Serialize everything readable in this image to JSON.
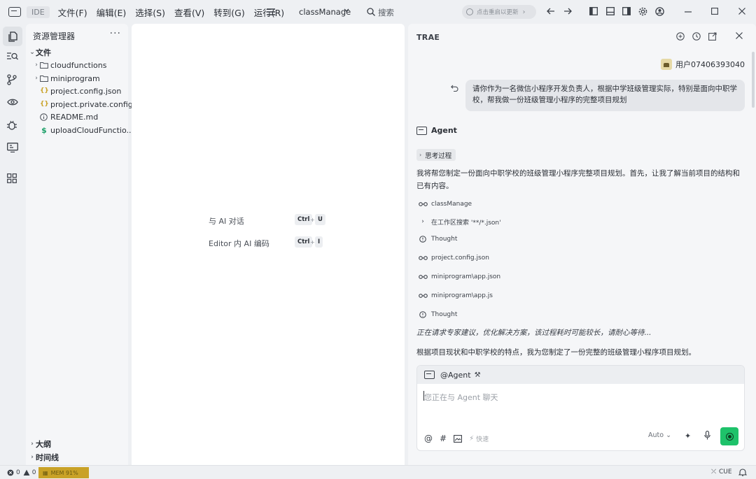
{
  "titlebar": {
    "ide_label": "IDE",
    "menu": [
      "文件(F)",
      "编辑(E)",
      "选择(S)",
      "查看(V)",
      "转到(G)",
      "运行(R)"
    ],
    "project": "classManage",
    "search": "搜索",
    "update_label": "点击重启以更新"
  },
  "explorer": {
    "title": "资源管理器",
    "more": "···",
    "root": "文件",
    "items": [
      {
        "name": "cloudfunctions",
        "type": "folder"
      },
      {
        "name": "miniprogram",
        "type": "folder"
      },
      {
        "name": "project.config.json",
        "type": "json"
      },
      {
        "name": "project.private.config...",
        "type": "json"
      },
      {
        "name": "README.md",
        "type": "info"
      },
      {
        "name": "uploadCloudFunctio...",
        "type": "script"
      }
    ],
    "outline": "大纲",
    "timeline": "时间线"
  },
  "editor": {
    "hints": [
      {
        "label": "与 AI 对话",
        "keys": [
          "Ctrl",
          "U"
        ]
      },
      {
        "label": "Editor 内 AI 编码",
        "keys": [
          "Ctrl",
          "I"
        ]
      }
    ]
  },
  "chat": {
    "title": "TRAE",
    "user_name": "用户07406393040",
    "user_message": "请你作为一名微信小程序开发负责人，根据中学班级管理实际，特别是面向中职学校，帮我做一份班级管理小程序的完整项目规划",
    "agent_name": "Agent",
    "thinking_label": "思考过程",
    "intro": "我将帮您制定一份面向中职学校的班级管理小程序完整项目规划。首先，让我了解当前项目的结构和已有内容。",
    "steps": [
      {
        "icon": "glasses",
        "text": "classManage"
      },
      {
        "icon": "chevron",
        "text": "在工作区搜索 '**/*.json'"
      },
      {
        "icon": "thought",
        "text": "Thought"
      },
      {
        "icon": "glasses",
        "text": "project.config.json"
      },
      {
        "icon": "glasses",
        "text": "miniprogram\\app.json"
      },
      {
        "icon": "glasses",
        "text": "miniprogram\\app.js"
      },
      {
        "icon": "thought",
        "text": "Thought"
      }
    ],
    "waiting": "正在请求专家建议，优化解决方案，该过程耗时可能较长，请耐心等待...",
    "summary": "根据项目现状和中职学校的特点，我为您制定了一份完整的班级管理小程序项目规划。",
    "composer": {
      "mention": "@Agent",
      "placeholder": "您正在与 Agent 聊天",
      "fast_label": "快速",
      "model": "Auto"
    }
  },
  "statusbar": {
    "errors": "0",
    "warnings": "0",
    "mem": "MEM 91%",
    "cue": "CUE"
  },
  "colors": {
    "accent_green": "#1ec26a",
    "mem_badge": "#c9a227"
  }
}
